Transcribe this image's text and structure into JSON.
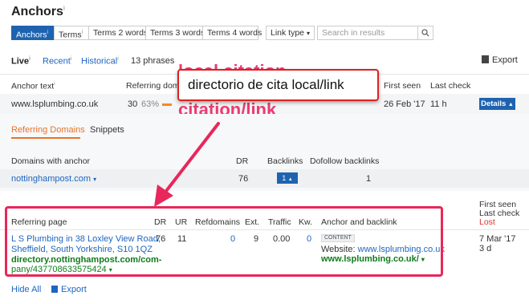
{
  "header": {
    "title": "Anchors",
    "info": "i"
  },
  "tabs": [
    {
      "label": "Anchors",
      "active": true
    },
    {
      "label": "Terms"
    },
    {
      "label": "Terms 2 words"
    },
    {
      "label": "Terms 3 words"
    },
    {
      "label": "Terms 4 words"
    }
  ],
  "link_type": "Link type",
  "search": {
    "placeholder": "Search in results"
  },
  "modes": [
    "Live",
    "Recent",
    "Historical"
  ],
  "phrases": "13 phrases",
  "export_label": "Export",
  "table": {
    "headers": {
      "anchor": "Anchor text",
      "ref_domains": "Referring doma",
      "first_seen": "First seen",
      "last_check": "Last check"
    },
    "row": {
      "anchor": "www.lsplumbing.co.uk",
      "count": "30",
      "percent": "63%",
      "first_seen": "26 Feb '17",
      "last_check": "11 h",
      "details": "Details"
    }
  },
  "callout": {
    "text": "directorio de cita local/link",
    "bg_text_top": "local citation",
    "bg_text_bottom": "citation/link"
  },
  "subtabs": [
    "Referring Domains",
    "Snippets"
  ],
  "domains": {
    "headers": {
      "domain": "Domains with anchor",
      "dr": "DR",
      "backlinks": "Backlinks",
      "dofollow": "Dofollow backlinks"
    },
    "row": {
      "domain": "nottinghampost.com",
      "dr": "76",
      "backlinks": "1",
      "dofollow": "1"
    }
  },
  "refpages": {
    "headers": {
      "page": "Referring page",
      "dr": "DR",
      "ur": "UR",
      "refdomains": "Refdomains",
      "ext": "Ext.",
      "traffic": "Traffic",
      "kw": "Kw.",
      "anchor": "Anchor and backlink",
      "first_seen": "First seen",
      "last_check": "Last check",
      "lost": "Lost"
    },
    "row": {
      "title_1": "L S Plumbing in 38 Loxley View Road,",
      "title_2": "Sheffield, South Yorkshire, S10 1QZ",
      "url_1": "directory.nottinghampost.com/com-",
      "url_2": "pany/437708633575424",
      "dr": "76",
      "ur": "11",
      "refdomains": "0",
      "ext": "9",
      "traffic": "0.00",
      "kw": "0",
      "badge": "CONTENT",
      "website_label": "Website:",
      "website_link": "www.lsplumbing.co.uk",
      "backlink": "www.lsplumbing.co.uk/",
      "first_seen": "7 Mar '17",
      "last_check": "3 d"
    }
  },
  "footer": {
    "hide_all": "Hide All",
    "export": "Export"
  },
  "colors": {
    "accent": "#1e63b0",
    "highlight": "#e8275b",
    "green": "#0f7b1b"
  }
}
